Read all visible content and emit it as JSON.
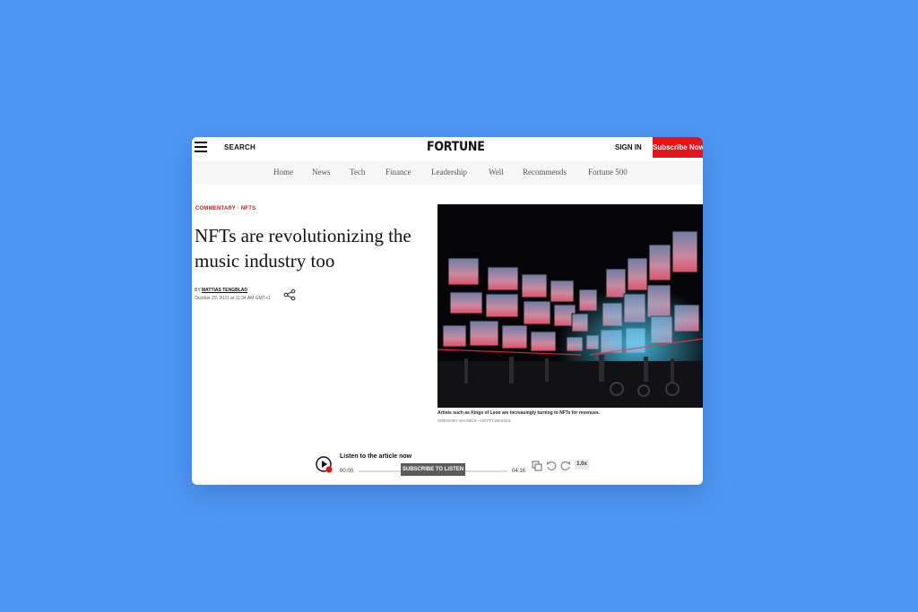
{
  "header": {
    "menu_icon": "hamburger-menu-icon",
    "search_label": "SEARCH",
    "logo_text": "FORTUNE",
    "signin_label": "SIGN IN",
    "subscribe_label": "Subscribe Now"
  },
  "nav": {
    "items": [
      {
        "label": "Home"
      },
      {
        "label": "News"
      },
      {
        "label": "Tech"
      },
      {
        "label": "Finance"
      },
      {
        "label": "Leadership"
      },
      {
        "label": "Well"
      },
      {
        "label": "Recommends"
      },
      {
        "label": "Fortune 500"
      }
    ]
  },
  "article": {
    "kicker": "COMMENTARY · NFTS",
    "headline": "NFTs are revolutionizing the music industry too",
    "byline_prefix": "BY",
    "author": "MATTIAS TENGBLAD",
    "date": "October 29, 2021 at 11:34 AM GMT+1",
    "share_icon": "share-icon",
    "image_caption": "Artists such as Kings of Leon are increasingly turning to NFTs for revenues.",
    "image_credit": "GREGORY SHAMUS—GETTY IMAGES"
  },
  "player": {
    "play_icon": "play-icon",
    "title": "Listen to the article now",
    "time_start": "00:00",
    "time_end": "04:16",
    "subscribe_label": "SUBSCRIBE TO LISTEN",
    "speed": "1.0x",
    "controls": [
      "translate-icon",
      "rewind-icon",
      "forward-icon"
    ]
  },
  "colors": {
    "background": "#4f97f3",
    "accent_red": "#e4141b",
    "kicker_red": "#d21a1f"
  }
}
